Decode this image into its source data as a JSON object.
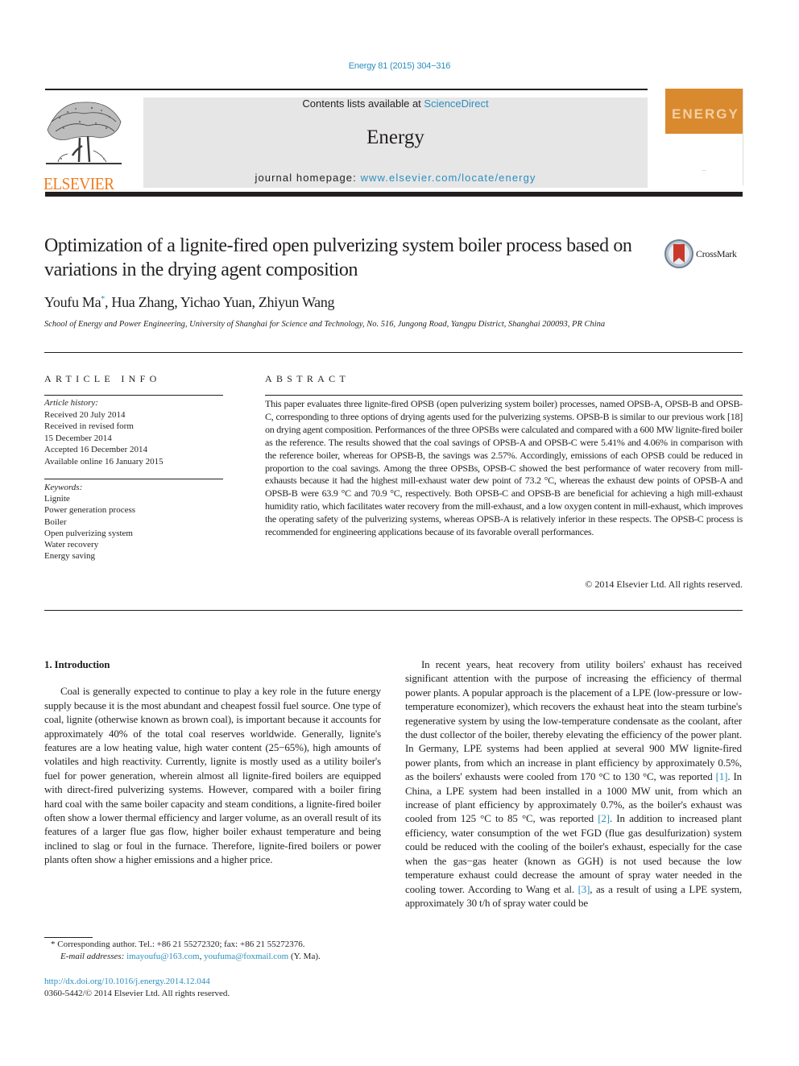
{
  "header": {
    "citation": "Energy 81 (2015) 304−316",
    "contents_prefix": "Contents lists available at ",
    "contents_link": "ScienceDirect",
    "journal_name": "Energy",
    "homepage_prefix": "journal homepage: ",
    "homepage_link": "www.elsevier.com/locate/energy",
    "publisher_wordmark": "ELSEVIER",
    "cover_title": "ENERGY",
    "brand_color": "#f07c1c",
    "link_color": "#2b8fc0"
  },
  "article": {
    "title": "Optimization of a lignite-fired open pulverizing system boiler process based on variations in the drying agent composition",
    "crossmark_label": "CrossMark",
    "authors": [
      {
        "name": "Youfu Ma",
        "marker": "*"
      },
      {
        "name": "Hua Zhang"
      },
      {
        "name": "Yichao Yuan"
      },
      {
        "name": "Zhiyun Wang"
      }
    ],
    "authors_sep": ", ",
    "affiliation": "School of Energy and Power Engineering, University of Shanghai for Science and Technology, No. 516, Jungong Road, Yangpu District, Shanghai 200093, PR China"
  },
  "article_info": {
    "heading": "ARTICLE INFO",
    "history_label": "Article history:",
    "history": [
      "Received 20 July 2014",
      "Received in revised form",
      "15 December 2014",
      "Accepted 16 December 2014",
      "Available online 16 January 2015"
    ],
    "keywords_label": "Keywords:",
    "keywords": [
      "Lignite",
      "Power generation process",
      "Boiler",
      "Open pulverizing system",
      "Water recovery",
      "Energy saving"
    ]
  },
  "abstract": {
    "heading": "ABSTRACT",
    "text": "This paper evaluates three lignite-fired OPSB (open pulverizing system boiler) processes, named OPSB-A, OPSB-B and OPSB-C, corresponding to three options of drying agents used for the pulverizing systems. OPSB-B is similar to our previous work [18] on drying agent composition. Performances of the three OPSBs were calculated and compared with a 600 MW lignite-fired boiler as the reference. The results showed that the coal savings of OPSB-A and OPSB-C were 5.41% and 4.06% in comparison with the reference boiler, whereas for OPSB-B, the savings was 2.57%. Accordingly, emissions of each OPSB could be reduced in proportion to the coal savings. Among the three OPSBs, OPSB-C showed the best performance of water recovery from mill-exhausts because it had the highest mill-exhaust water dew point of 73.2 °C, whereas the exhaust dew points of OPSB-A and OPSB-B were 63.9 °C and 70.9 °C, respectively. Both OPSB-C and OPSB-B are beneficial for achieving a high mill-exhaust humidity ratio, which facilitates water recovery from the mill-exhaust, and a low oxygen content in mill-exhaust, which improves the operating safety of the pulverizing systems, whereas OPSB-A is relatively inferior in these respects. The OPSB-C process is recommended for engineering applications because of its favorable overall performances.",
    "copyright": "© 2014 Elsevier Ltd. All rights reserved."
  },
  "body": {
    "section_heading": "1.  Introduction",
    "left_paragraph": "Coal is generally expected to continue to play a key role in the future energy supply because it is the most abundant and cheapest fossil fuel source. One type of coal, lignite (otherwise known as brown coal), is important because it accounts for approximately 40% of the total coal reserves worldwide. Generally, lignite's features are a low heating value, high water content (25−65%), high amounts of volatiles and high reactivity. Currently, lignite is mostly used as a utility boiler's fuel for power generation, wherein almost all lignite-fired boilers are equipped with direct-fired pulverizing systems. However, compared with a boiler firing hard coal with the same boiler capacity and steam conditions, a lignite-fired boiler often show a lower thermal efficiency and larger volume, as an overall result of its features of a larger flue gas flow, higher boiler exhaust temperature and being inclined to slag or foul in the furnace. Therefore, lignite-fired boilers or power plants often show a higher emissions and a higher price.",
    "right_paragraph": {
      "part1": "In recent years, heat recovery from utility boilers' exhaust has received significant attention with the purpose of increasing the efficiency of thermal power plants. A popular approach is the placement of a LPE (low-pressure or low-temperature economizer), which recovers the exhaust heat into the steam turbine's regenerative system by using the low-temperature condensate as the coolant, after the dust collector of the boiler, thereby elevating the efficiency of the power plant. In Germany, LPE systems had been applied at several 900 MW lignite-fired power plants, from which an increase in plant efficiency by approximately 0.5%, as the boilers' exhausts were cooled from 170 °C to 130 °C, was reported ",
      "ref1": "[1]",
      "part2": ". In China, a LPE system had been installed in a 1000 MW unit, from which an increase of plant efficiency by approximately 0.7%, as the boiler's exhaust was cooled from 125 °C to 85 °C, was reported ",
      "ref2": "[2]",
      "part3": ". In addition to increased plant efficiency, water consumption of the wet FGD (flue gas desulfurization) system could be reduced with the cooling of the boiler's exhaust, especially for the case when the gas−gas heater (known as GGH) is not used because the low temperature exhaust could decrease the amount of spray water needed in the cooling tower. According to Wang et al. ",
      "ref3": "[3]",
      "part4": ", as a result of using a LPE system, approximately 30 t/h of spray water could be"
    }
  },
  "footnote": {
    "marker": "*",
    "corresponding": " Corresponding author. Tel.: +86 21 55272320; fax: +86 21 55272376.",
    "email_label": "E-mail addresses:",
    "email1": "imayoufu@163.com",
    "email_sep": ", ",
    "email2": "youfuma@foxmail.com",
    "email_suffix": " (Y. Ma).",
    "doi": "http://dx.doi.org/10.1016/j.energy.2014.12.044",
    "issn": "0360-5442/© 2014 Elsevier Ltd. All rights reserved."
  }
}
